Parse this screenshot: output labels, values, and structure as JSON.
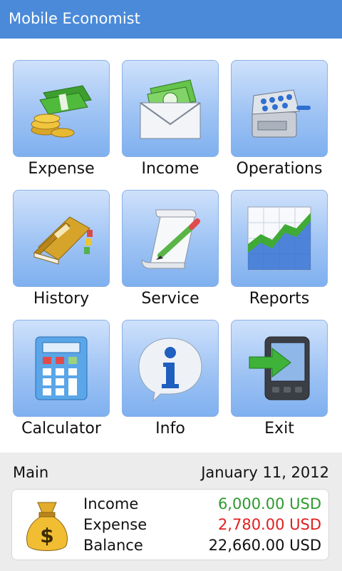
{
  "app": {
    "title": "Mobile Economist"
  },
  "menu": [
    {
      "id": "expense",
      "label": "Expense",
      "icon": "money-coins-icon"
    },
    {
      "id": "income",
      "label": "Income",
      "icon": "envelope-money-icon"
    },
    {
      "id": "operations",
      "label": "Operations",
      "icon": "cash-register-icon"
    },
    {
      "id": "history",
      "label": "History",
      "icon": "ledger-book-icon"
    },
    {
      "id": "service",
      "label": "Service",
      "icon": "scroll-pen-icon"
    },
    {
      "id": "reports",
      "label": "Reports",
      "icon": "area-chart-icon"
    },
    {
      "id": "calculator",
      "label": "Calculator",
      "icon": "calculator-icon"
    },
    {
      "id": "info",
      "label": "Info",
      "icon": "info-icon"
    },
    {
      "id": "exit",
      "label": "Exit",
      "icon": "exit-device-icon"
    }
  ],
  "summary": {
    "account": "Main",
    "date": "January 11, 2012",
    "rows": [
      {
        "label": "Income",
        "value": "6,000.00 USD",
        "color": "#2e9a2e"
      },
      {
        "label": "Expense",
        "value": "2,780.00 USD",
        "color": "#e21e1e"
      },
      {
        "label": "Balance",
        "value": "22,660.00 USD",
        "color": "#111111"
      }
    ]
  },
  "colors": {
    "titlebar": "#4a8ad9",
    "tile_border": "#8ab1e8"
  }
}
